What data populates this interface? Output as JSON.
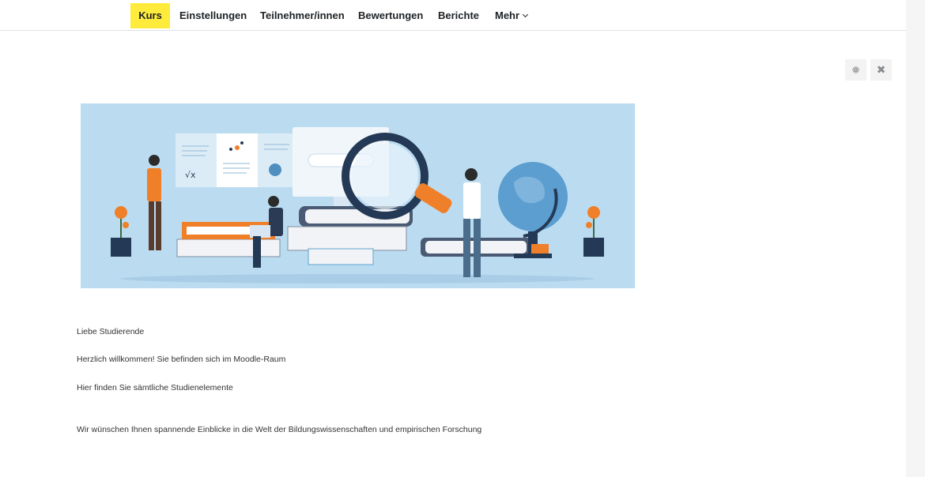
{
  "nav": {
    "tabs": [
      {
        "label": "Kurs",
        "active": true
      },
      {
        "label": "Einstellungen",
        "active": false
      },
      {
        "label": "Teilnehmer/innen",
        "active": false
      },
      {
        "label": "Bewertungen",
        "active": false
      },
      {
        "label": "Berichte",
        "active": false
      },
      {
        "label": "Mehr",
        "active": false
      }
    ],
    "active_color": "#ffeb3b"
  },
  "actions": {
    "settings_icon": "gear-icon",
    "close_icon": "close-icon",
    "close_glyph": "✖"
  },
  "content": {
    "paragraphs": [
      "Liebe Studierende",
      "Herzlich willkommen! Sie befinden sich im Moodle-Raum",
      "Hier finden Sie sämtliche Studienelemente",
      "Wir wünschen Ihnen spannende Einblicke in die Welt der Bildungswissenschaften und empirischen Forschung"
    ]
  },
  "banner": {
    "background_color": "#bbdcf0",
    "accent_color": "#f07f2a",
    "formula_glyph": "√x"
  }
}
